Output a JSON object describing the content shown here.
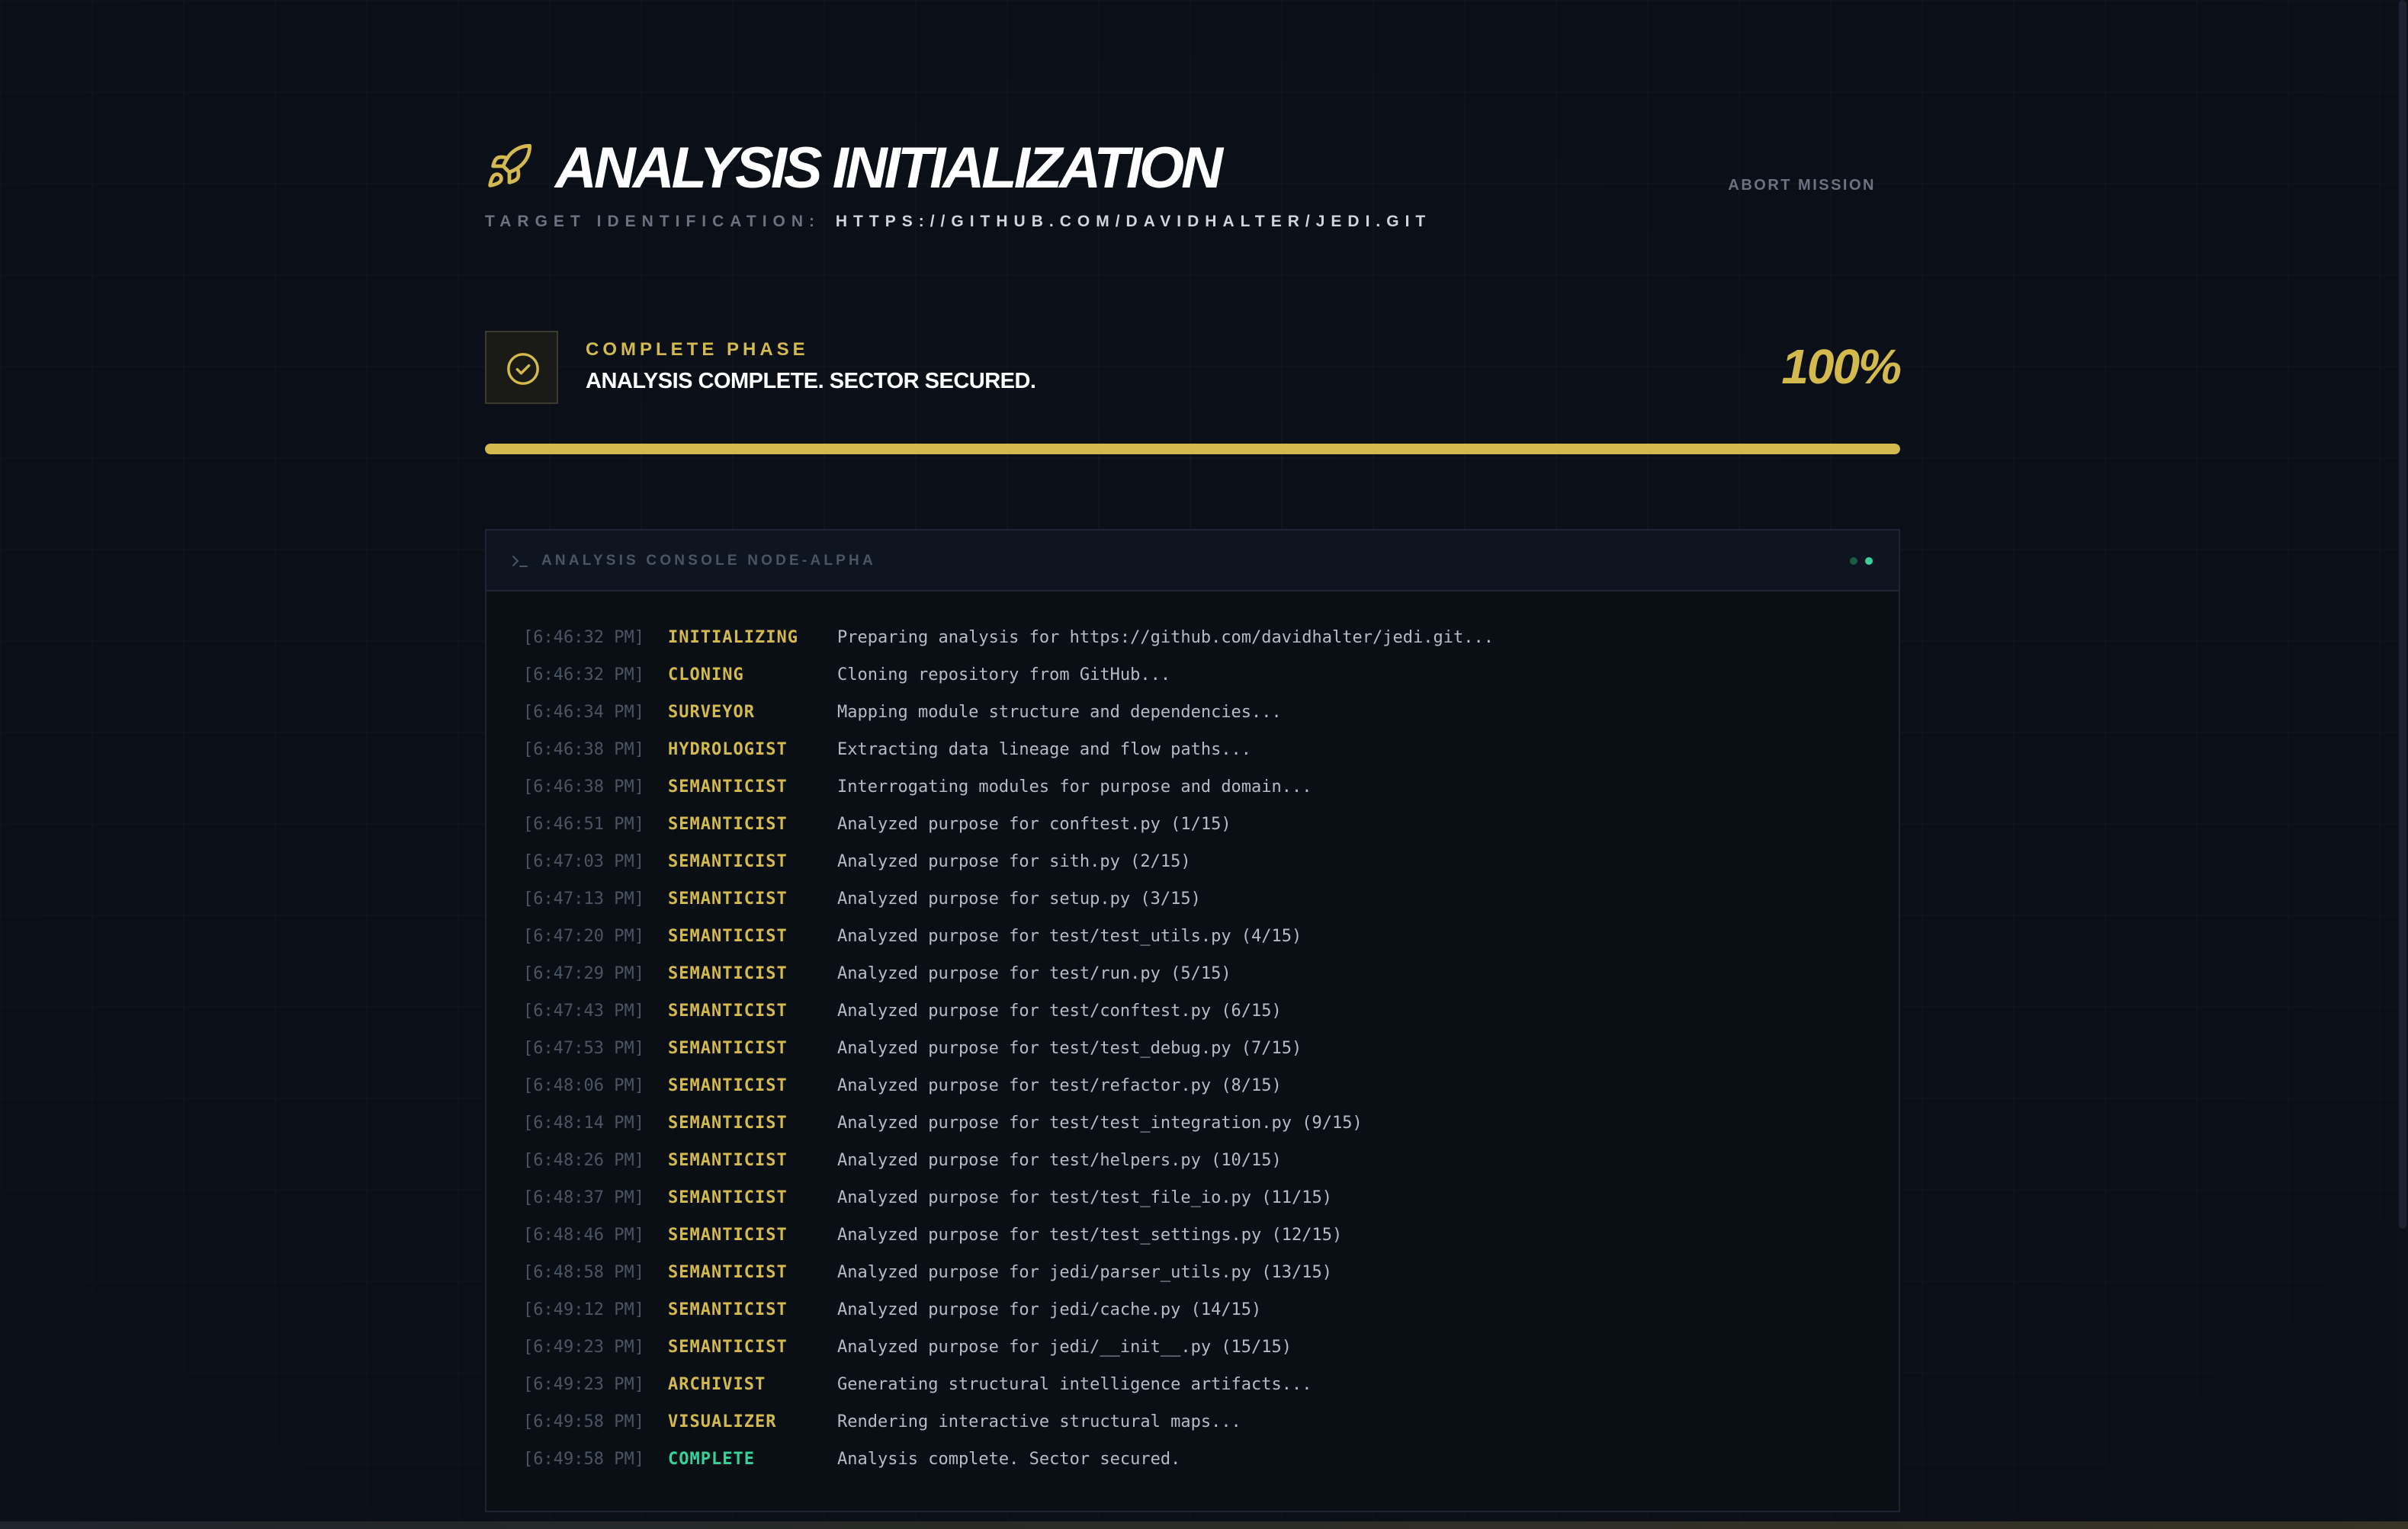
{
  "header": {
    "title": "ANALYSIS INITIALIZATION",
    "target_label": "TARGET IDENTIFICATION:",
    "target_url": "HTTPS://GITHUB.COM/DAVIDHALTER/JEDI.GIT",
    "abort_label": "ABORT MISSION",
    "icon": "rocket-icon"
  },
  "phase": {
    "label": "COMPLETE PHASE",
    "message": "ANALYSIS COMPLETE. SECTOR SECURED.",
    "percent_text": "100%",
    "progress_fraction": 1.0,
    "icon": "check-circle-icon"
  },
  "console": {
    "title": "ANALYSIS CONSOLE NODE-ALPHA",
    "icon": "terminal-icon",
    "logs": [
      {
        "time": "[6:46:32 PM]",
        "tag": "INITIALIZING",
        "msg": "Preparing analysis for https://github.com/davidhalter/jedi.git..."
      },
      {
        "time": "[6:46:32 PM]",
        "tag": "CLONING",
        "msg": "Cloning repository from GitHub..."
      },
      {
        "time": "[6:46:34 PM]",
        "tag": "SURVEYOR",
        "msg": "Mapping module structure and dependencies..."
      },
      {
        "time": "[6:46:38 PM]",
        "tag": "HYDROLOGIST",
        "msg": "Extracting data lineage and flow paths..."
      },
      {
        "time": "[6:46:38 PM]",
        "tag": "SEMANTICIST",
        "msg": "Interrogating modules for purpose and domain..."
      },
      {
        "time": "[6:46:51 PM]",
        "tag": "SEMANTICIST",
        "msg": "Analyzed purpose for conftest.py (1/15)"
      },
      {
        "time": "[6:47:03 PM]",
        "tag": "SEMANTICIST",
        "msg": "Analyzed purpose for sith.py (2/15)"
      },
      {
        "time": "[6:47:13 PM]",
        "tag": "SEMANTICIST",
        "msg": "Analyzed purpose for setup.py (3/15)"
      },
      {
        "time": "[6:47:20 PM]",
        "tag": "SEMANTICIST",
        "msg": "Analyzed purpose for test/test_utils.py (4/15)"
      },
      {
        "time": "[6:47:29 PM]",
        "tag": "SEMANTICIST",
        "msg": "Analyzed purpose for test/run.py (5/15)"
      },
      {
        "time": "[6:47:43 PM]",
        "tag": "SEMANTICIST",
        "msg": "Analyzed purpose for test/conftest.py (6/15)"
      },
      {
        "time": "[6:47:53 PM]",
        "tag": "SEMANTICIST",
        "msg": "Analyzed purpose for test/test_debug.py (7/15)"
      },
      {
        "time": "[6:48:06 PM]",
        "tag": "SEMANTICIST",
        "msg": "Analyzed purpose for test/refactor.py (8/15)"
      },
      {
        "time": "[6:48:14 PM]",
        "tag": "SEMANTICIST",
        "msg": "Analyzed purpose for test/test_integration.py (9/15)"
      },
      {
        "time": "[6:48:26 PM]",
        "tag": "SEMANTICIST",
        "msg": "Analyzed purpose for test/helpers.py (10/15)"
      },
      {
        "time": "[6:48:37 PM]",
        "tag": "SEMANTICIST",
        "msg": "Analyzed purpose for test/test_file_io.py (11/15)"
      },
      {
        "time": "[6:48:46 PM]",
        "tag": "SEMANTICIST",
        "msg": "Analyzed purpose for test/test_settings.py (12/15)"
      },
      {
        "time": "[6:48:58 PM]",
        "tag": "SEMANTICIST",
        "msg": "Analyzed purpose for jedi/parser_utils.py (13/15)"
      },
      {
        "time": "[6:49:12 PM]",
        "tag": "SEMANTICIST",
        "msg": "Analyzed purpose for jedi/cache.py (14/15)"
      },
      {
        "time": "[6:49:23 PM]",
        "tag": "SEMANTICIST",
        "msg": "Analyzed purpose for jedi/__init__.py (15/15)"
      },
      {
        "time": "[6:49:23 PM]",
        "tag": "ARCHIVIST",
        "msg": "Generating structural intelligence artifacts..."
      },
      {
        "time": "[6:49:58 PM]",
        "tag": "VISUALIZER",
        "msg": "Rendering interactive structural maps..."
      },
      {
        "time": "[6:49:58 PM]",
        "tag": "COMPLETE",
        "msg": "Analysis complete. Sector secured."
      }
    ]
  },
  "colors": {
    "background": "#0b0f17",
    "accent": "#d4b94e",
    "success": "#34d399",
    "muted": "#6b7280"
  }
}
